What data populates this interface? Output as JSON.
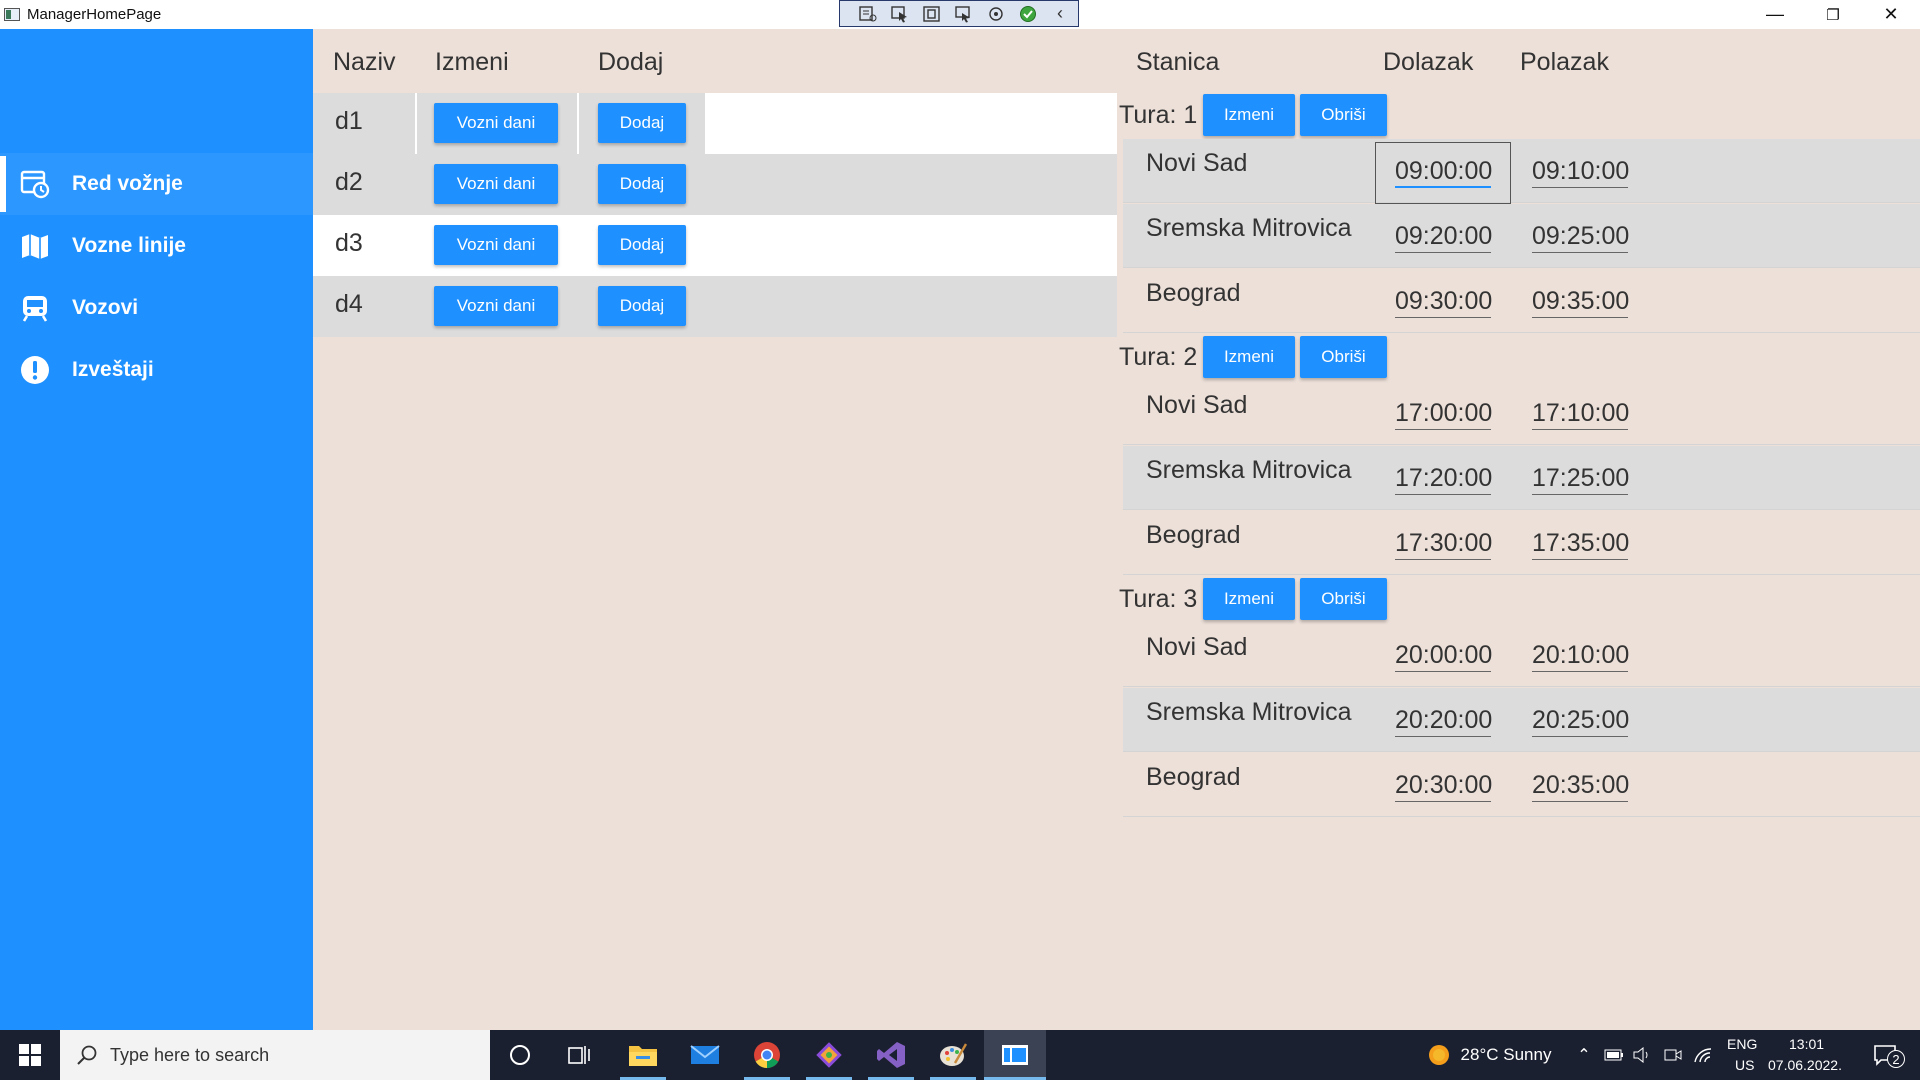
{
  "window": {
    "title": "ManagerHomePage",
    "minimize": "—",
    "maximize": "❐",
    "close": "✕"
  },
  "sidebar": {
    "items": [
      {
        "label": "Red vožnje",
        "icon": "schedule-icon",
        "active": true
      },
      {
        "label": "Vozne linije",
        "icon": "map-icon",
        "active": false
      },
      {
        "label": "Vozovi",
        "icon": "train-icon",
        "active": false
      },
      {
        "label": "Izveštaji",
        "icon": "alert-icon",
        "active": false
      }
    ]
  },
  "left_table": {
    "headers": {
      "name": "Naziv",
      "edit": "Izmeni",
      "add": "Dodaj"
    },
    "rows": [
      {
        "name": "d1",
        "edit_label": "Vozni dani",
        "add_label": "Dodaj"
      },
      {
        "name": "d2",
        "edit_label": "Vozni dani",
        "add_label": "Dodaj"
      },
      {
        "name": "d3",
        "edit_label": "Vozni dani",
        "add_label": "Dodaj"
      },
      {
        "name": "d4",
        "edit_label": "Vozni dani",
        "add_label": "Dodaj"
      }
    ]
  },
  "right_table": {
    "headers": {
      "station": "Stanica",
      "arrival": "Dolazak",
      "departure": "Polazak"
    },
    "tours": [
      {
        "label": "Tura:",
        "number": "1",
        "edit_label": "Izmeni",
        "delete_label": "Obriši",
        "stops": [
          {
            "station": "Novi Sad",
            "arrival": "09:00:00",
            "departure": "09:10:00"
          },
          {
            "station": "Sremska Mitrovica",
            "arrival": "09:20:00",
            "departure": "09:25:00"
          },
          {
            "station": "Beograd",
            "arrival": "09:30:00",
            "departure": "09:35:00"
          }
        ]
      },
      {
        "label": "Tura:",
        "number": "2",
        "edit_label": "Izmeni",
        "delete_label": "Obriši",
        "stops": [
          {
            "station": "Novi Sad",
            "arrival": "17:00:00",
            "departure": "17:10:00"
          },
          {
            "station": "Sremska Mitrovica",
            "arrival": "17:20:00",
            "departure": "17:25:00"
          },
          {
            "station": "Beograd",
            "arrival": "17:30:00",
            "departure": "17:35:00"
          }
        ]
      },
      {
        "label": "Tura:",
        "number": "3",
        "edit_label": "Izmeni",
        "delete_label": "Obriši",
        "stops": [
          {
            "station": "Novi Sad",
            "arrival": "20:00:00",
            "departure": "20:10:00"
          },
          {
            "station": "Sremska Mitrovica",
            "arrival": "20:20:00",
            "departure": "20:25:00"
          },
          {
            "station": "Beograd",
            "arrival": "20:30:00",
            "departure": "20:35:00"
          }
        ]
      }
    ]
  },
  "taskbar": {
    "search_placeholder": "Type here to search",
    "weather": "28°C  Sunny",
    "lang_top": "ENG",
    "lang_bottom": "US",
    "time": "13:01",
    "date": "07.06.2022.",
    "notifications": "2"
  },
  "colors": {
    "accent": "#1e90ff",
    "background": "#ede0d9",
    "row_gray": "#dcdcdc",
    "taskbar": "#1b2030"
  }
}
